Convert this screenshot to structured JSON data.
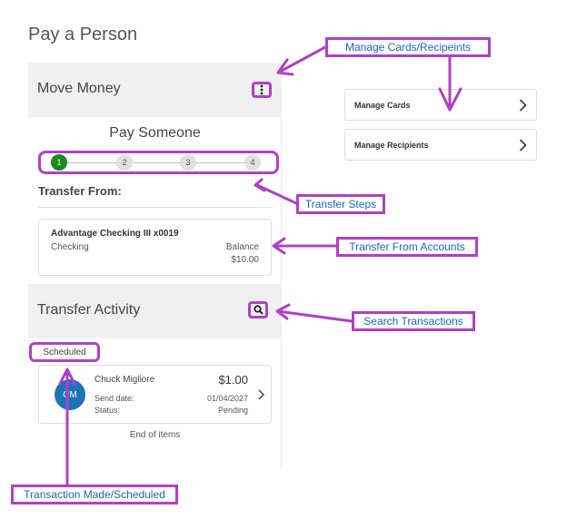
{
  "page": {
    "title": "Pay a Person"
  },
  "move_money": {
    "title": "Move Money",
    "pay_someone": "Pay Someone",
    "steps": [
      "1",
      "2",
      "3",
      "4"
    ],
    "active_step": 1,
    "transfer_from_label": "Transfer From:",
    "account": {
      "name": "Advantage Checking III x0019",
      "type": "Checking",
      "balance_label": "Balance",
      "balance": "$10.00"
    }
  },
  "transfer_activity": {
    "title": "Transfer Activity",
    "scheduled_label": "Scheduled",
    "transaction": {
      "initials": "CM",
      "payee": "Chuck Migliore",
      "amount": "$1.00",
      "send_date_label": "Send date:",
      "send_date": "01/04/2027",
      "status_label": "Status:",
      "status": "Pending"
    },
    "end_of_items": "End of items"
  },
  "side_menu": {
    "manage_cards": "Manage Cards",
    "manage_recipients": "Manage Recipients"
  },
  "callouts": {
    "manage": "Manage Cards/Recipeints",
    "steps": "Transfer Steps",
    "accounts": "Transfer From Accounts",
    "search": "Search Transactions",
    "made": "Transaction Made/Scheduled"
  },
  "colors": {
    "annotation": "#b13fc7",
    "callout_text": "#1a66cc",
    "active_step": "#1a8a1a",
    "avatar": "#1b74b6"
  },
  "icons": {
    "more": "kebab-vertical-icon",
    "search": "magnifier-icon",
    "chevron": "chevron-right-icon"
  }
}
